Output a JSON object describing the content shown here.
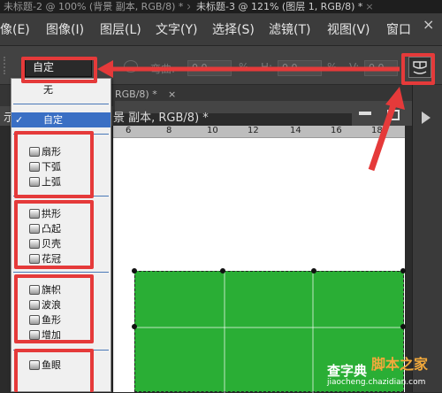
{
  "doc_tabs": [
    {
      "label": "未标题-2 @ 100% (背景 副本, RGB/8) *",
      "close": "×"
    },
    {
      "label": "未标题-3 @ 121% (图层 1, RGB/8) *",
      "close": "×"
    }
  ],
  "menubar": {
    "items": [
      "像(E)",
      "图像(I)",
      "图层(L)",
      "文字(Y)",
      "选择(S)",
      "滤镜(T)",
      "视图(V)",
      "窗口"
    ],
    "close_icon": "×"
  },
  "options": {
    "preset_value": "自定",
    "bend_label": "弯曲:",
    "bend_value": "0.0",
    "h_label": "H:",
    "h_value": "0.0",
    "v_label": "V:",
    "v_value": "0.0",
    "percent": "%"
  },
  "document": {
    "tab_label": "RGB/8) *",
    "tab_close": "×",
    "title_fragment": "景 副本, RGB/8) *",
    "ruler_marks": [
      "6",
      "8",
      "10",
      "12",
      "14",
      "16",
      "18"
    ]
  },
  "dropdown": {
    "items": [
      {
        "label": "无",
        "checked": false
      },
      {
        "label": "自定",
        "checked": true
      },
      {
        "label": "扇形"
      },
      {
        "label": "下弧"
      },
      {
        "label": "上弧"
      },
      {
        "label": "拱形"
      },
      {
        "label": "凸起"
      },
      {
        "label": "贝壳"
      },
      {
        "label": "花冠"
      },
      {
        "label": "旗帜"
      },
      {
        "label": "波浪"
      },
      {
        "label": "鱼形"
      },
      {
        "label": "增加"
      },
      {
        "label": "鱼眼"
      }
    ],
    "check_mark": "✓"
  },
  "watermark": {
    "site": "查字典",
    "brand": "脚本之家",
    "url": "jiaocheng.chazidian.com"
  },
  "colors": {
    "annotation_red": "#e53a3a",
    "canvas_green": "#2aae35",
    "selected_blue": "#3a6fc4"
  }
}
